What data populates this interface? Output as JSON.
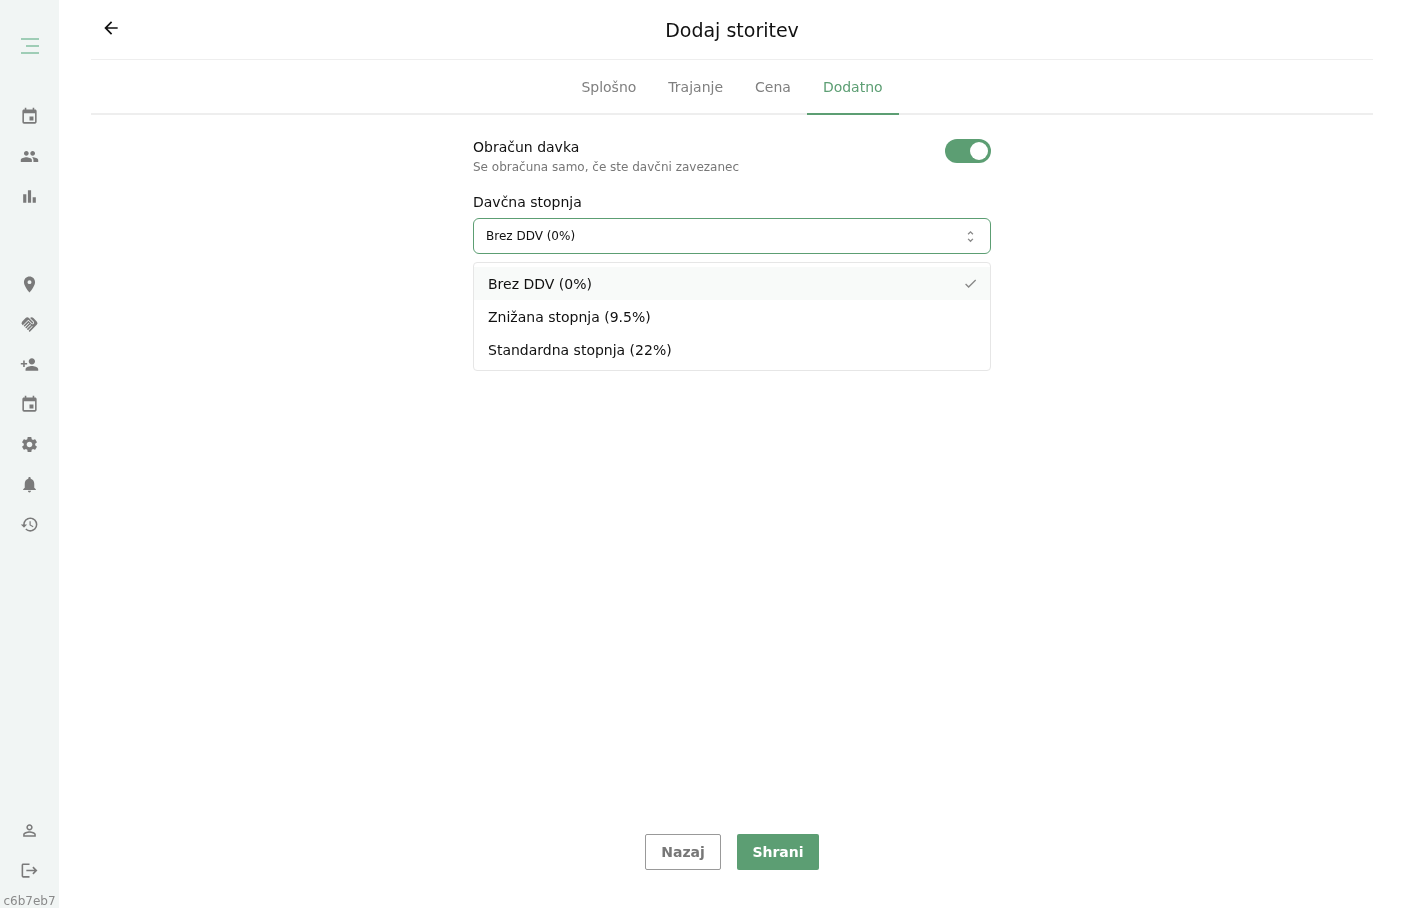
{
  "sidebar": {
    "top_items": [
      {
        "kind": "calendar"
      },
      {
        "kind": "people"
      },
      {
        "kind": "chart"
      }
    ],
    "middle_items": [
      {
        "kind": "location"
      },
      {
        "kind": "handshake"
      },
      {
        "kind": "person-add"
      },
      {
        "kind": "calendar"
      },
      {
        "kind": "settings"
      },
      {
        "kind": "bell"
      },
      {
        "kind": "history"
      }
    ],
    "bottom_items": [
      {
        "kind": "person"
      },
      {
        "kind": "logout"
      }
    ],
    "version": "c6b7eb7"
  },
  "header": {
    "title": "Dodaj storitev"
  },
  "tabs": [
    {
      "label": "Splošno",
      "selected": false
    },
    {
      "label": "Trajanje",
      "selected": false
    },
    {
      "label": "Cena",
      "selected": false
    },
    {
      "label": "Dodatno",
      "selected": true
    }
  ],
  "tax_toggle": {
    "label": "Obračun davka",
    "hint": "Se obračuna samo, če ste davčni zavezanec",
    "on": true
  },
  "tax_rate": {
    "label": "Davčna stopnja",
    "value": "Brez DDV (0%)",
    "expanded": true,
    "options": [
      {
        "label": "Brez DDV (0%)",
        "selected": true
      },
      {
        "label": "Znižana stopnja (9.5%)",
        "selected": false
      },
      {
        "label": "Standardna stopnja (22%)",
        "selected": false
      }
    ]
  },
  "buttons": {
    "back": "Nazaj",
    "save": "Shrani"
  }
}
